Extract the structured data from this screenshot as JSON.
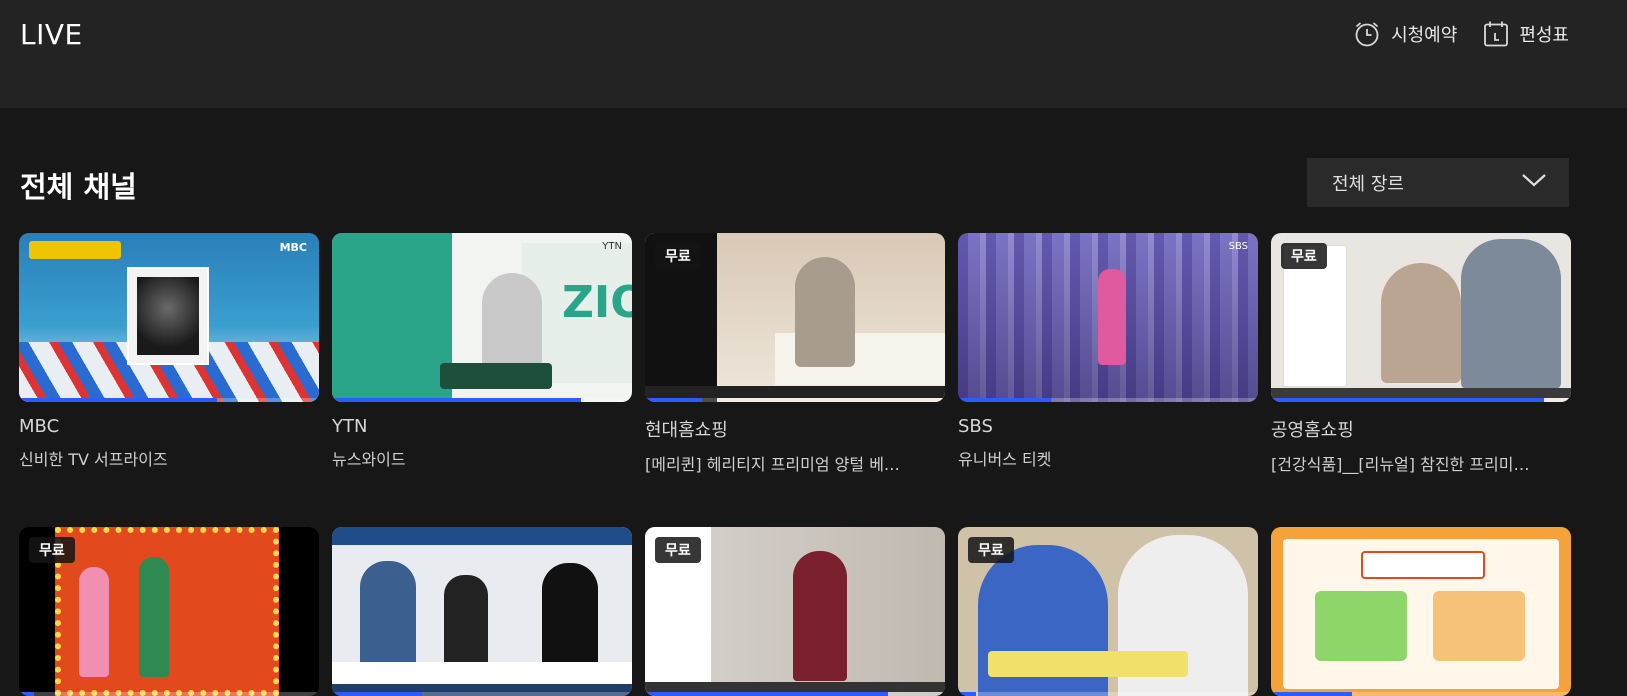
{
  "header": {
    "title": "LIVE",
    "reserve_label": "시청예약",
    "schedule_label": "편성표"
  },
  "section": {
    "title": "전체 채널",
    "genre_select": "전체 장르"
  },
  "badge_free": "무료",
  "colors": {
    "accent": "#2a5cff",
    "background": "#171717",
    "topbar": "#232323"
  },
  "channels": [
    {
      "name": "MBC",
      "program": "신비한 TV 서프라이즈",
      "free": false,
      "progress": 0.66,
      "scene": "mbc"
    },
    {
      "name": "YTN",
      "program": "뉴스와이드",
      "free": false,
      "progress": 0.83,
      "scene": "ytn"
    },
    {
      "name": "현대홈쇼핑",
      "program": "[메리퀸] 헤리티지 프리미엄 양털 베…",
      "free": true,
      "progress": 0.19,
      "scene": "hyundai"
    },
    {
      "name": "SBS",
      "program": "유니버스 티켓",
      "free": false,
      "progress": 0.31,
      "scene": "sbs"
    },
    {
      "name": "공영홈쇼핑",
      "program": "[건강식품]__[리뉴얼] 참진한 프리미…",
      "free": true,
      "progress": 0.91,
      "scene": "gongyoung"
    },
    {
      "name": "",
      "program": "",
      "free": true,
      "progress": 0.05,
      "scene": "retro"
    },
    {
      "name": "",
      "program": "",
      "free": false,
      "progress": 0.3,
      "scene": "yonhap"
    },
    {
      "name": "",
      "program": "",
      "free": true,
      "progress": 0.81,
      "scene": "skstoa"
    },
    {
      "name": "",
      "program": "",
      "free": true,
      "progress": 0.06,
      "scene": "food"
    },
    {
      "name": "",
      "program": "",
      "free": false,
      "progress": 0.27,
      "scene": "kids"
    }
  ]
}
